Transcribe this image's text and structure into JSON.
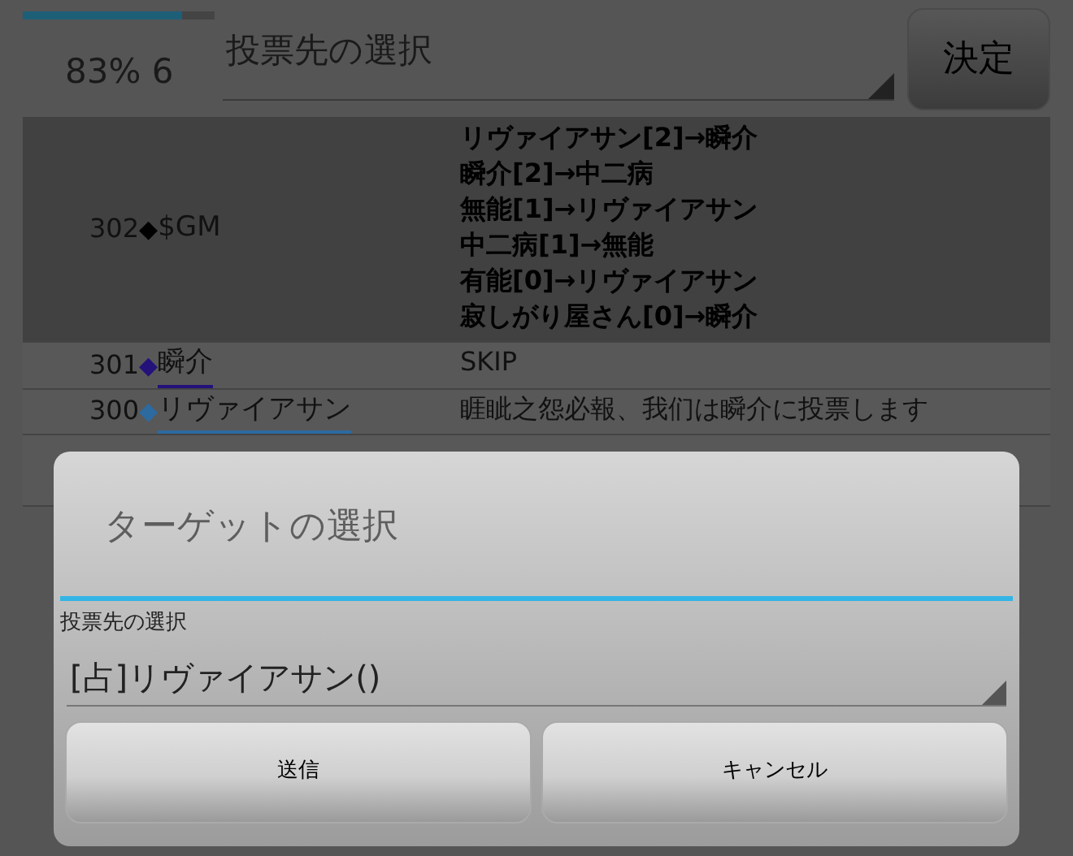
{
  "header": {
    "progress": {
      "level": 0.83
    },
    "status": "83% 6",
    "select": {
      "value": "投票先の選択"
    },
    "confirm_button": "決定"
  },
  "log_rows": [
    {
      "number": "302",
      "marker": "◆",
      "color": "#000000",
      "name": "$GM",
      "link": false,
      "highlighted": true,
      "lines": [
        "リヴァイアサン[2]→瞬介",
        "瞬介[2]→中二病",
        "無能[1]→リヴァイアサン",
        "中二病[1]→無能",
        "有能[0]→リヴァイアサン",
        "寂しがり屋さん[0]→瞬介"
      ]
    },
    {
      "number": "301",
      "marker": "◆",
      "color": "#24127a",
      "name": "瞬介",
      "link": true,
      "highlighted": false,
      "lines": [
        "SKIP"
      ]
    },
    {
      "number": "300",
      "marker": "◆",
      "color": "#2c6aa0",
      "name": "リヴァイアサン",
      "link": true,
      "highlighted": false,
      "lines": [
        "睚眦之怨必報、我们は瞬介に投票します"
      ]
    }
  ],
  "dialog": {
    "title": "ターゲットの選択",
    "field_label": "投票先の選択",
    "select_value": "[占]リヴァイアサン()",
    "buttons": [
      "送信",
      "キャンセル"
    ]
  }
}
